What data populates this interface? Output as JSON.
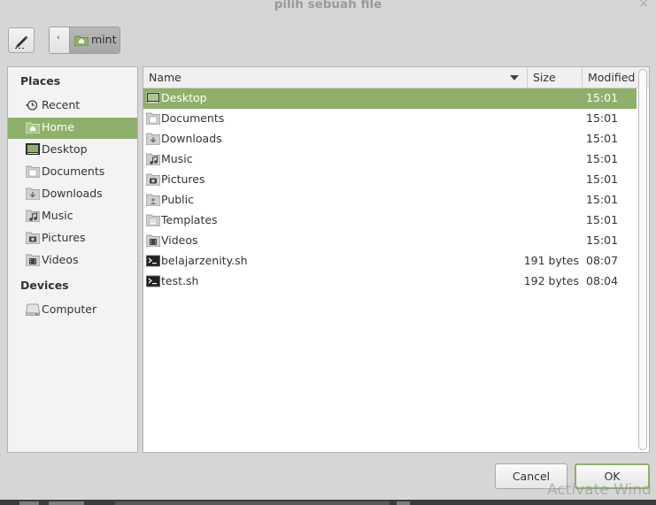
{
  "window": {
    "title": "pilih sebuah file",
    "close_glyph": "×"
  },
  "toolbar": {
    "edit_icon": "pencil-icon",
    "back_glyph": "‹",
    "breadcrumb": "mint"
  },
  "sidebar": {
    "places_heading": "Places",
    "places": [
      {
        "label": "Recent",
        "icon": "recent-icon"
      },
      {
        "label": "Home",
        "icon": "home-folder-icon",
        "selected": true
      },
      {
        "label": "Desktop",
        "icon": "desktop-icon"
      },
      {
        "label": "Documents",
        "icon": "documents-folder-icon"
      },
      {
        "label": "Downloads",
        "icon": "downloads-folder-icon"
      },
      {
        "label": "Music",
        "icon": "music-folder-icon"
      },
      {
        "label": "Pictures",
        "icon": "pictures-folder-icon"
      },
      {
        "label": "Videos",
        "icon": "videos-folder-icon"
      }
    ],
    "devices_heading": "Devices",
    "devices": [
      {
        "label": "Computer",
        "icon": "computer-icon"
      }
    ]
  },
  "files": {
    "columns": {
      "name": "Name",
      "size": "Size",
      "modified": "Modified"
    },
    "rows": [
      {
        "name": "Desktop",
        "size": "",
        "modified": "15:01",
        "icon": "desktop-icon",
        "selected": true
      },
      {
        "name": "Documents",
        "size": "",
        "modified": "15:01",
        "icon": "documents-folder-icon"
      },
      {
        "name": "Downloads",
        "size": "",
        "modified": "15:01",
        "icon": "downloads-folder-icon"
      },
      {
        "name": "Music",
        "size": "",
        "modified": "15:01",
        "icon": "music-folder-icon"
      },
      {
        "name": "Pictures",
        "size": "",
        "modified": "15:01",
        "icon": "pictures-folder-icon"
      },
      {
        "name": "Public",
        "size": "",
        "modified": "15:01",
        "icon": "public-folder-icon"
      },
      {
        "name": "Templates",
        "size": "",
        "modified": "15:01",
        "icon": "templates-folder-icon"
      },
      {
        "name": "Videos",
        "size": "",
        "modified": "15:01",
        "icon": "videos-folder-icon"
      },
      {
        "name": "belajarzenity.sh",
        "size": "191 bytes",
        "modified": "08:07",
        "icon": "terminal-script-icon"
      },
      {
        "name": "test.sh",
        "size": "192 bytes",
        "modified": "08:04",
        "icon": "terminal-script-icon"
      }
    ]
  },
  "buttons": {
    "cancel": "Cancel",
    "ok": "OK"
  },
  "watermark": "Activate Wind",
  "colors": {
    "accent": "#8fb06a"
  }
}
